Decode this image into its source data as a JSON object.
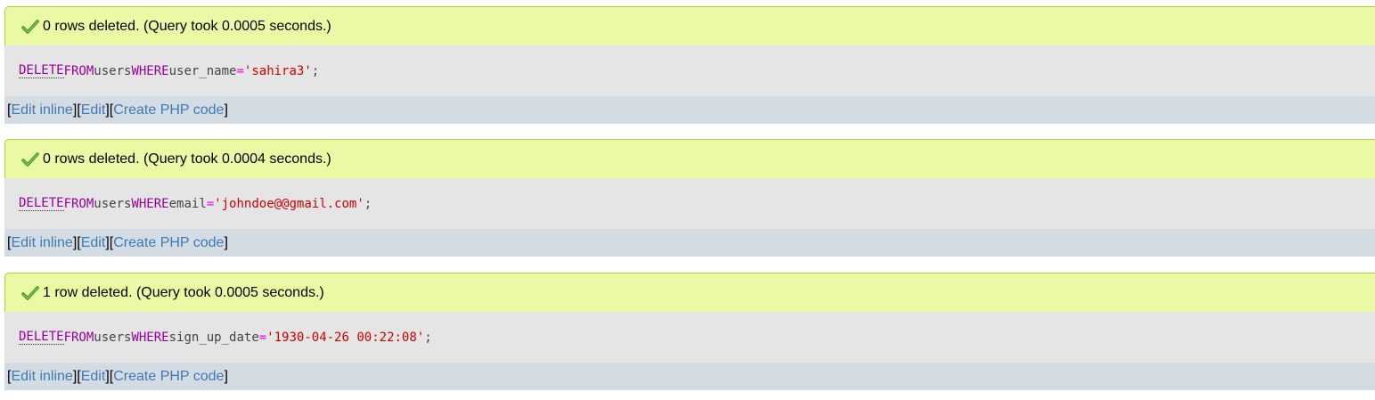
{
  "results": [
    {
      "message": "0 rows deleted. (Query took 0.0005 seconds.)",
      "sql": {
        "delete": "DELETE",
        "from": "FROM",
        "table": "users",
        "where": "WHERE",
        "column": "user_name",
        "operator": "=",
        "value": "'sahira3'",
        "terminator": ";"
      }
    },
    {
      "message": "0 rows deleted. (Query took 0.0004 seconds.)",
      "sql": {
        "delete": "DELETE",
        "from": "FROM",
        "table": "users",
        "where": "WHERE",
        "column": "email",
        "operator": "=",
        "value": "'johndoe@@gmail.com'",
        "terminator": ";"
      }
    },
    {
      "message": "1 row deleted. (Query took 0.0005 seconds.)",
      "sql": {
        "delete": "DELETE",
        "from": "FROM",
        "table": "users",
        "where": "WHERE",
        "column": "sign_up_date",
        "operator": "=",
        "value": "'1930-04-26 00:22:08'",
        "terminator": ";"
      }
    }
  ],
  "actions": {
    "edit_inline": "Edit inline",
    "edit": "Edit",
    "create_php": "Create PHP code",
    "open_bracket": "[",
    "close_bracket": "]"
  },
  "icons": {
    "success": "check-icon"
  },
  "colors": {
    "success_bg": "#ebf8a4",
    "success_border": "#a2d246",
    "sql_bg": "#e5e5e5",
    "actions_bg": "#d3dce3",
    "keyword": "#990099",
    "string": "#cc0000",
    "operator": "#ff00ff",
    "link": "#3d7ab8"
  }
}
